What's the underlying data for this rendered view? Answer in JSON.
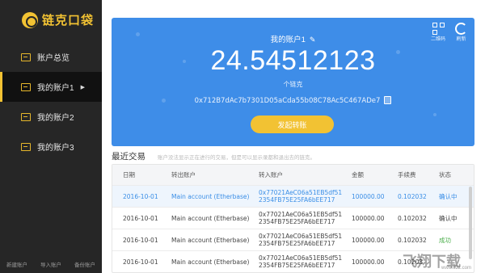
{
  "app": {
    "logo_text": "链克口袋"
  },
  "sidebar": {
    "items": [
      {
        "label": "账户总览",
        "active": false
      },
      {
        "label": "我的账户1",
        "active": true
      },
      {
        "label": "我的账户2",
        "active": false
      },
      {
        "label": "我的账户3",
        "active": false
      }
    ],
    "footer": [
      "新建账户",
      "导入账户",
      "备份账户"
    ]
  },
  "account": {
    "title": "我的账户1",
    "balance": "24.54512123",
    "unit": "个链克",
    "address": "0x712B7dAc7b7301D05aCda55b08C78Ac5C467ADe7",
    "transfer_label": "发起转账",
    "qr_label": "二维码",
    "refresh_label": "刷新"
  },
  "transactions": {
    "title": "最近交易",
    "hint": "账户没法显示正在进行的交易，但是可以显示录都和退出去的链克。",
    "columns": [
      "日期",
      "转出账户",
      "转入账户",
      "金额",
      "手续费",
      "状态"
    ],
    "rows": [
      {
        "date": "2016-10-01",
        "from": "Main account (Etherbase)",
        "to1": "0x77021AeC06a51EB5df51",
        "to2": "2354FB75E25FA6bEE717",
        "amount": "100000.00",
        "fee": "0.102032",
        "status": "确认中"
      },
      {
        "date": "2016-10-01",
        "from": "Main account (Etherbase)",
        "to1": "0x77021AeC06a51EB5df51",
        "to2": "2354FB75E25FA6bEE717",
        "amount": "100000.00",
        "fee": "0.102032",
        "status": "确认中"
      },
      {
        "date": "2016-10-01",
        "from": "Main account (Etherbase)",
        "to1": "0x77021AeC06a51EB5df51",
        "to2": "2354FB75E25FA6bEE717",
        "amount": "100000.00",
        "fee": "0.102032",
        "status": "成功"
      },
      {
        "date": "2016-10-01",
        "from": "Main account (Etherbase)",
        "to1": "0x77021AeC06a51EB5df51",
        "to2": "2354FB75E25FA6bEE717",
        "amount": "100000.00",
        "fee": "0.10203",
        "status": ""
      }
    ]
  },
  "watermark": {
    "text": "飞翔下载",
    "url": "www.52z.com"
  },
  "colors": {
    "card": "#3e8de8",
    "accent": "#f2c233",
    "sidebar": "#262626"
  }
}
